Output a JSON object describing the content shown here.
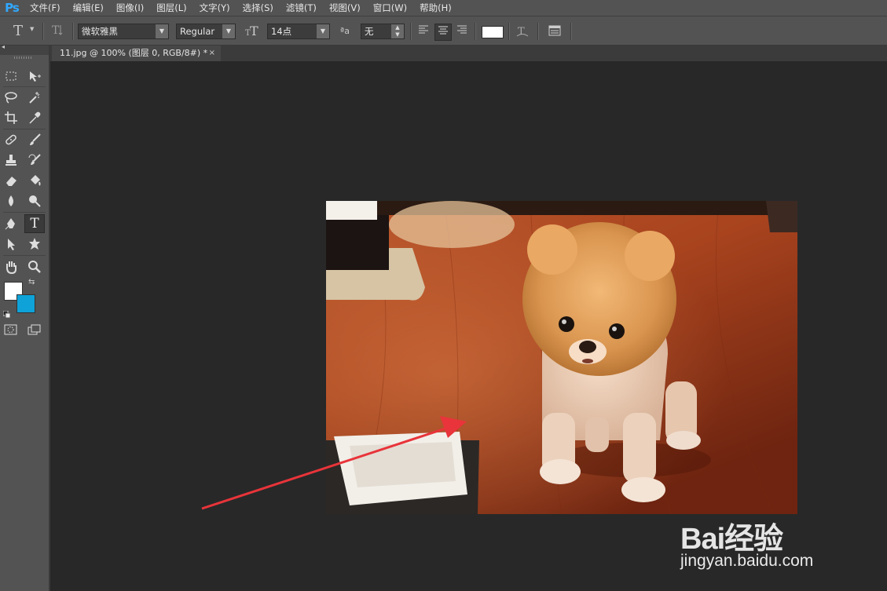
{
  "app": {
    "logo": "Ps"
  },
  "menubar": {
    "items": [
      "文件(F)",
      "编辑(E)",
      "图像(I)",
      "图层(L)",
      "文字(Y)",
      "选择(S)",
      "滤镜(T)",
      "视图(V)",
      "窗口(W)",
      "帮助(H)"
    ]
  },
  "options": {
    "tool_icon": "T",
    "font_family": "微软雅黑",
    "font_style": "Regular",
    "font_size": "14点",
    "antialias_label": "ªa",
    "antialias": "无",
    "text_color": "#ffffff"
  },
  "document": {
    "tab_title": "11.jpg @ 100% (图层 0, RGB/8#) *",
    "close_glyph": "×"
  },
  "toolbar": {
    "collapse_glyph": "◂",
    "foreground_color": "#ffffff",
    "background_color": "#0ea2d8"
  },
  "annotation": {
    "arrow_color": "#e8343a"
  },
  "watermark": {
    "brand": "Bai经验",
    "url": "jingyan.baidu.com"
  }
}
